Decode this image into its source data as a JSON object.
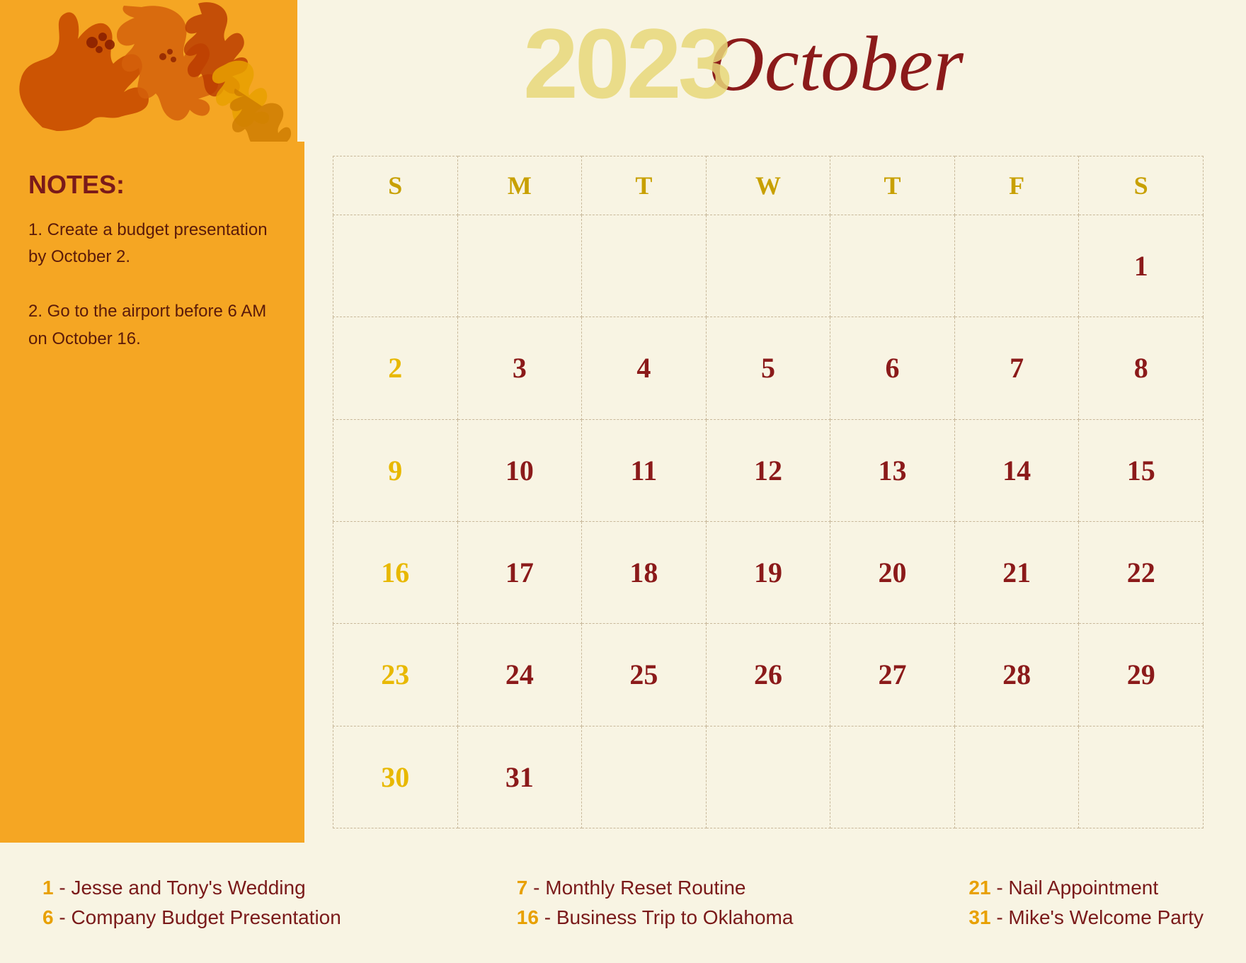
{
  "header": {
    "year": "2023",
    "month": "October"
  },
  "notes": {
    "title": "NOTES:",
    "items": [
      "1. Create a budget presentation by October 2.",
      "2. Go to the airport before 6 AM on October 16."
    ]
  },
  "calendar": {
    "days_header": [
      "S",
      "M",
      "T",
      "W",
      "T",
      "F",
      "S"
    ],
    "weeks": [
      [
        {
          "day": "",
          "type": "empty"
        },
        {
          "day": "",
          "type": "empty"
        },
        {
          "day": "",
          "type": "empty"
        },
        {
          "day": "",
          "type": "empty"
        },
        {
          "day": "",
          "type": "empty"
        },
        {
          "day": "",
          "type": "empty"
        },
        {
          "day": "1",
          "type": "sun"
        }
      ],
      [
        {
          "day": "2",
          "type": "weekday"
        },
        {
          "day": "3",
          "type": "weekday"
        },
        {
          "day": "4",
          "type": "weekday"
        },
        {
          "day": "5",
          "type": "weekday"
        },
        {
          "day": "6",
          "type": "weekday"
        },
        {
          "day": "7",
          "type": "weekday"
        },
        {
          "day": "8",
          "type": "sun"
        }
      ],
      [
        {
          "day": "9",
          "type": "weekday"
        },
        {
          "day": "10",
          "type": "weekday"
        },
        {
          "day": "11",
          "type": "weekday"
        },
        {
          "day": "12",
          "type": "weekday"
        },
        {
          "day": "13",
          "type": "weekday"
        },
        {
          "day": "14",
          "type": "weekday"
        },
        {
          "day": "15",
          "type": "sun"
        }
      ],
      [
        {
          "day": "16",
          "type": "weekday"
        },
        {
          "day": "17",
          "type": "weekday"
        },
        {
          "day": "18",
          "type": "weekday"
        },
        {
          "day": "19",
          "type": "weekday"
        },
        {
          "day": "20",
          "type": "weekday"
        },
        {
          "day": "21",
          "type": "weekday"
        },
        {
          "day": "22",
          "type": "sun"
        }
      ],
      [
        {
          "day": "23",
          "type": "weekday"
        },
        {
          "day": "24",
          "type": "weekday"
        },
        {
          "day": "25",
          "type": "weekday"
        },
        {
          "day": "26",
          "type": "weekday"
        },
        {
          "day": "27",
          "type": "weekday"
        },
        {
          "day": "28",
          "type": "weekday"
        },
        {
          "day": "29",
          "type": "sun"
        }
      ],
      [
        {
          "day": "30",
          "type": "weekday"
        },
        {
          "day": "31",
          "type": "weekday"
        },
        {
          "day": "",
          "type": "empty"
        },
        {
          "day": "",
          "type": "empty"
        },
        {
          "day": "",
          "type": "empty"
        },
        {
          "day": "",
          "type": "empty"
        },
        {
          "day": "",
          "type": "empty"
        }
      ]
    ]
  },
  "events": {
    "columns": [
      [
        {
          "number": "1",
          "text": " -  Jesse and Tony's Wedding"
        },
        {
          "number": "6",
          "text": " -  Company Budget Presentation"
        }
      ],
      [
        {
          "number": "7",
          "text": " - Monthly Reset Routine"
        },
        {
          "number": "16",
          "text": " - Business Trip to Oklahoma"
        }
      ],
      [
        {
          "number": "21",
          "text": " - Nail Appointment"
        },
        {
          "number": "31",
          "text": " - Mike's Welcome Party"
        }
      ]
    ]
  }
}
